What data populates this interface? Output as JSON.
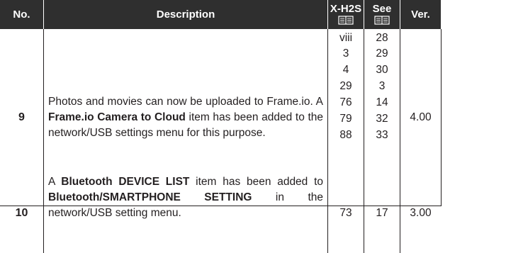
{
  "header": {
    "no": "No.",
    "description": "Description",
    "xh2s_line1": "X-H2S",
    "see_line1": "See",
    "ver": "Ver.",
    "book_icon": "book-icon"
  },
  "rows": [
    {
      "no": "9",
      "desc_part1": "Photos and movies can now be uploaded to Frame.io. A ",
      "desc_bold1": "Frame.io Camera to Cloud",
      "desc_part2": " item has been added to the network/USB settings menu for this purpose.",
      "xh2s_pages": [
        "viii",
        "3",
        "4",
        "29",
        "76",
        "79",
        "88"
      ],
      "see_pages": [
        "28",
        "29",
        "30",
        "3",
        "14",
        "32",
        "33"
      ],
      "ver": "4.00"
    },
    {
      "no": "10",
      "desc_part1": "A ",
      "desc_bold1": "Bluetooth DEVICE LIST",
      "desc_part2": " item has been added to ",
      "desc_bold2": "Bluetooth/SMARTPHONE SETTING",
      "desc_part3": " in the network/USB setting menu.",
      "xh2s_pages": [
        "73"
      ],
      "see_pages": [
        "17"
      ],
      "ver": "3.00"
    }
  ]
}
